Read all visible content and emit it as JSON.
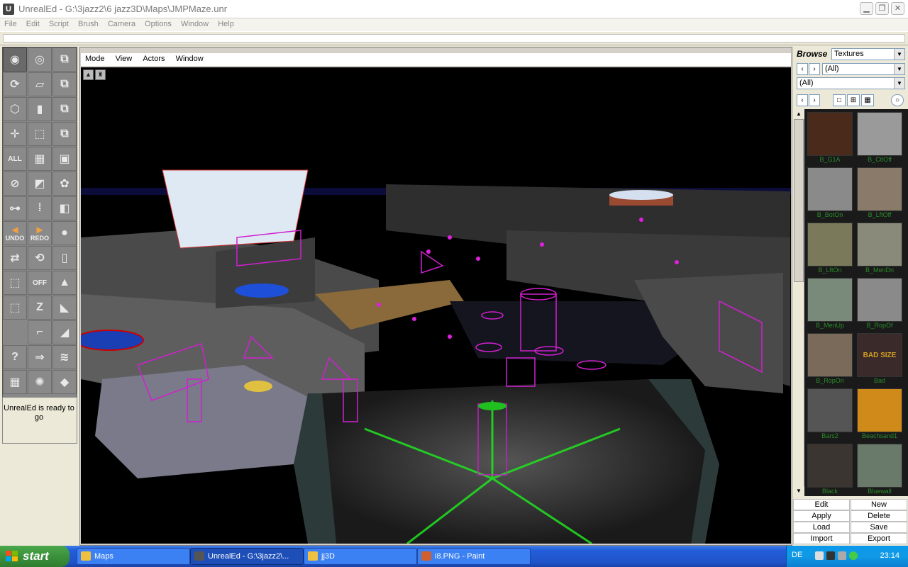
{
  "window": {
    "title": "UnrealEd - G:\\3jazz2\\6 jazz3D\\Maps\\JMPMaze.unr"
  },
  "menubar": [
    "File",
    "Edit",
    "Script",
    "Brush",
    "Camera",
    "Options",
    "Window",
    "Help"
  ],
  "tools": {
    "all_label": "ALL",
    "undo_label": "UNDO",
    "redo_label": "REDO",
    "off_label": "OFF",
    "status": "UnrealEd is ready to go"
  },
  "viewport": {
    "menu": [
      "Mode",
      "View",
      "Actors",
      "Window"
    ]
  },
  "browser": {
    "label": "Browse",
    "type": "Textures",
    "package": "(All)",
    "group": "(All)",
    "textures": [
      {
        "name": "B_G1A",
        "color": "#4a2a1a"
      },
      {
        "name": "B_CtlOff",
        "color": "#9a9a9a"
      },
      {
        "name": "B_BotOn",
        "color": "#8a8a8a"
      },
      {
        "name": "B_LftOff",
        "color": "#8a7a6a"
      },
      {
        "name": "B_LftOn",
        "color": "#7a7a5a"
      },
      {
        "name": "B_MenDn",
        "color": "#8a8a7a"
      },
      {
        "name": "B_MenUp",
        "color": "#7a8a7a"
      },
      {
        "name": "B_RopOf",
        "color": "#8a8a8a"
      },
      {
        "name": "B_RopOn",
        "color": "#7a6a5a"
      },
      {
        "name": "Bad",
        "color": "#3a2a2a",
        "overlay": "BAD SIZE"
      },
      {
        "name": "Bars2",
        "color": "#555555"
      },
      {
        "name": "Beachsand1",
        "color": "#d08a1a"
      },
      {
        "name": "Black",
        "color": "#3a3530"
      },
      {
        "name": "Bluewall",
        "color": "#6a7a6a"
      }
    ],
    "buttons": {
      "edit": "Edit",
      "new": "New",
      "apply": "Apply",
      "delete": "Delete",
      "load": "Load",
      "save": "Save",
      "import": "Import",
      "export": "Export"
    }
  },
  "taskbar": {
    "start": "start",
    "tasks": [
      {
        "label": "Maps",
        "active": false
      },
      {
        "label": "UnrealEd - G:\\3jazz2\\...",
        "active": true
      },
      {
        "label": "jj3D",
        "active": false
      },
      {
        "label": "i8.PNG - Paint",
        "active": false
      }
    ],
    "language": "DE",
    "clock": "23:14"
  }
}
